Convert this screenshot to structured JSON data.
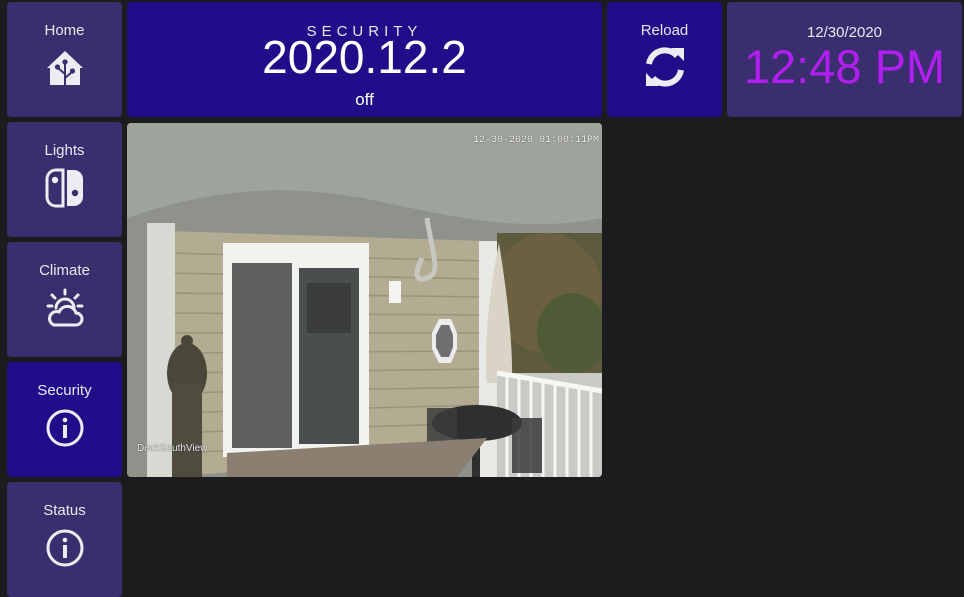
{
  "nav": {
    "items": [
      {
        "label": "Home",
        "icon": "home-assistant-icon"
      },
      {
        "label": "Lights",
        "icon": "nintendo-switch-icon"
      },
      {
        "label": "Climate",
        "icon": "weather-partly-cloudy-icon"
      },
      {
        "label": "Security",
        "icon": "information-icon",
        "active": true
      },
      {
        "label": "Status",
        "icon": "information-icon"
      }
    ]
  },
  "security": {
    "title": "SECURITY",
    "value": "2020.12.2",
    "state": "off"
  },
  "reload": {
    "label": "Reload",
    "icon": "refresh-icon"
  },
  "clock": {
    "date": "12/30/2020",
    "time": "12:48 PM"
  },
  "camera": {
    "timestamp": "12-30-2020 01:00:11PM",
    "name": "DeckSouthView"
  },
  "colors": {
    "background": "#1c1c1e",
    "tile": "#3a2e6e",
    "active_tile": "#1f0d8a",
    "time_accent": "#b21df0",
    "text": "#ffffff"
  }
}
